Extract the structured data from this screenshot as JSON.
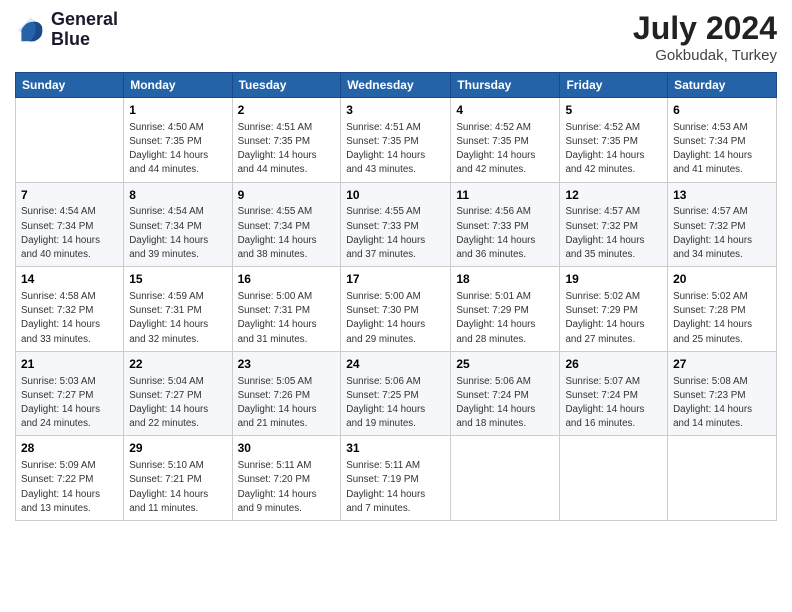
{
  "header": {
    "logo_line1": "General",
    "logo_line2": "Blue",
    "month_title": "July 2024",
    "subtitle": "Gokbudak, Turkey"
  },
  "weekdays": [
    "Sunday",
    "Monday",
    "Tuesday",
    "Wednesday",
    "Thursday",
    "Friday",
    "Saturday"
  ],
  "weeks": [
    [
      {
        "day": "",
        "info": ""
      },
      {
        "day": "1",
        "info": "Sunrise: 4:50 AM\nSunset: 7:35 PM\nDaylight: 14 hours\nand 44 minutes."
      },
      {
        "day": "2",
        "info": "Sunrise: 4:51 AM\nSunset: 7:35 PM\nDaylight: 14 hours\nand 44 minutes."
      },
      {
        "day": "3",
        "info": "Sunrise: 4:51 AM\nSunset: 7:35 PM\nDaylight: 14 hours\nand 43 minutes."
      },
      {
        "day": "4",
        "info": "Sunrise: 4:52 AM\nSunset: 7:35 PM\nDaylight: 14 hours\nand 42 minutes."
      },
      {
        "day": "5",
        "info": "Sunrise: 4:52 AM\nSunset: 7:35 PM\nDaylight: 14 hours\nand 42 minutes."
      },
      {
        "day": "6",
        "info": "Sunrise: 4:53 AM\nSunset: 7:34 PM\nDaylight: 14 hours\nand 41 minutes."
      }
    ],
    [
      {
        "day": "7",
        "info": "Sunrise: 4:54 AM\nSunset: 7:34 PM\nDaylight: 14 hours\nand 40 minutes."
      },
      {
        "day": "8",
        "info": "Sunrise: 4:54 AM\nSunset: 7:34 PM\nDaylight: 14 hours\nand 39 minutes."
      },
      {
        "day": "9",
        "info": "Sunrise: 4:55 AM\nSunset: 7:34 PM\nDaylight: 14 hours\nand 38 minutes."
      },
      {
        "day": "10",
        "info": "Sunrise: 4:55 AM\nSunset: 7:33 PM\nDaylight: 14 hours\nand 37 minutes."
      },
      {
        "day": "11",
        "info": "Sunrise: 4:56 AM\nSunset: 7:33 PM\nDaylight: 14 hours\nand 36 minutes."
      },
      {
        "day": "12",
        "info": "Sunrise: 4:57 AM\nSunset: 7:32 PM\nDaylight: 14 hours\nand 35 minutes."
      },
      {
        "day": "13",
        "info": "Sunrise: 4:57 AM\nSunset: 7:32 PM\nDaylight: 14 hours\nand 34 minutes."
      }
    ],
    [
      {
        "day": "14",
        "info": "Sunrise: 4:58 AM\nSunset: 7:32 PM\nDaylight: 14 hours\nand 33 minutes."
      },
      {
        "day": "15",
        "info": "Sunrise: 4:59 AM\nSunset: 7:31 PM\nDaylight: 14 hours\nand 32 minutes."
      },
      {
        "day": "16",
        "info": "Sunrise: 5:00 AM\nSunset: 7:31 PM\nDaylight: 14 hours\nand 31 minutes."
      },
      {
        "day": "17",
        "info": "Sunrise: 5:00 AM\nSunset: 7:30 PM\nDaylight: 14 hours\nand 29 minutes."
      },
      {
        "day": "18",
        "info": "Sunrise: 5:01 AM\nSunset: 7:29 PM\nDaylight: 14 hours\nand 28 minutes."
      },
      {
        "day": "19",
        "info": "Sunrise: 5:02 AM\nSunset: 7:29 PM\nDaylight: 14 hours\nand 27 minutes."
      },
      {
        "day": "20",
        "info": "Sunrise: 5:02 AM\nSunset: 7:28 PM\nDaylight: 14 hours\nand 25 minutes."
      }
    ],
    [
      {
        "day": "21",
        "info": "Sunrise: 5:03 AM\nSunset: 7:27 PM\nDaylight: 14 hours\nand 24 minutes."
      },
      {
        "day": "22",
        "info": "Sunrise: 5:04 AM\nSunset: 7:27 PM\nDaylight: 14 hours\nand 22 minutes."
      },
      {
        "day": "23",
        "info": "Sunrise: 5:05 AM\nSunset: 7:26 PM\nDaylight: 14 hours\nand 21 minutes."
      },
      {
        "day": "24",
        "info": "Sunrise: 5:06 AM\nSunset: 7:25 PM\nDaylight: 14 hours\nand 19 minutes."
      },
      {
        "day": "25",
        "info": "Sunrise: 5:06 AM\nSunset: 7:24 PM\nDaylight: 14 hours\nand 18 minutes."
      },
      {
        "day": "26",
        "info": "Sunrise: 5:07 AM\nSunset: 7:24 PM\nDaylight: 14 hours\nand 16 minutes."
      },
      {
        "day": "27",
        "info": "Sunrise: 5:08 AM\nSunset: 7:23 PM\nDaylight: 14 hours\nand 14 minutes."
      }
    ],
    [
      {
        "day": "28",
        "info": "Sunrise: 5:09 AM\nSunset: 7:22 PM\nDaylight: 14 hours\nand 13 minutes."
      },
      {
        "day": "29",
        "info": "Sunrise: 5:10 AM\nSunset: 7:21 PM\nDaylight: 14 hours\nand 11 minutes."
      },
      {
        "day": "30",
        "info": "Sunrise: 5:11 AM\nSunset: 7:20 PM\nDaylight: 14 hours\nand 9 minutes."
      },
      {
        "day": "31",
        "info": "Sunrise: 5:11 AM\nSunset: 7:19 PM\nDaylight: 14 hours\nand 7 minutes."
      },
      {
        "day": "",
        "info": ""
      },
      {
        "day": "",
        "info": ""
      },
      {
        "day": "",
        "info": ""
      }
    ]
  ]
}
